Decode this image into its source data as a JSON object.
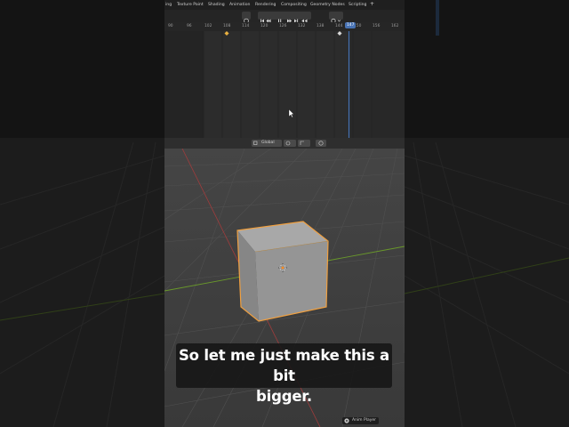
{
  "workspace_tabs": [
    "ing",
    "Texture Paint",
    "Shading",
    "Animation",
    "Rendering",
    "Compositing",
    "Geometry Nodes",
    "Scripting",
    "+"
  ],
  "ruler_ticks": [
    "90",
    "96",
    "102",
    "108",
    "114",
    "120",
    "126",
    "132",
    "138",
    "144",
    "150",
    "156",
    "162"
  ],
  "current_frame": "147",
  "viewport_header": {
    "orientation": "Global"
  },
  "subtitle": {
    "line1": "So let me just make this a bit",
    "line2": "bigger."
  },
  "badge": {
    "label": "Anim Player"
  },
  "colors": {
    "accent_blue": "#4772b3",
    "selection_orange": "#f0a040",
    "axis_red": "#a03c3c",
    "axis_green": "#6a9a2a"
  }
}
